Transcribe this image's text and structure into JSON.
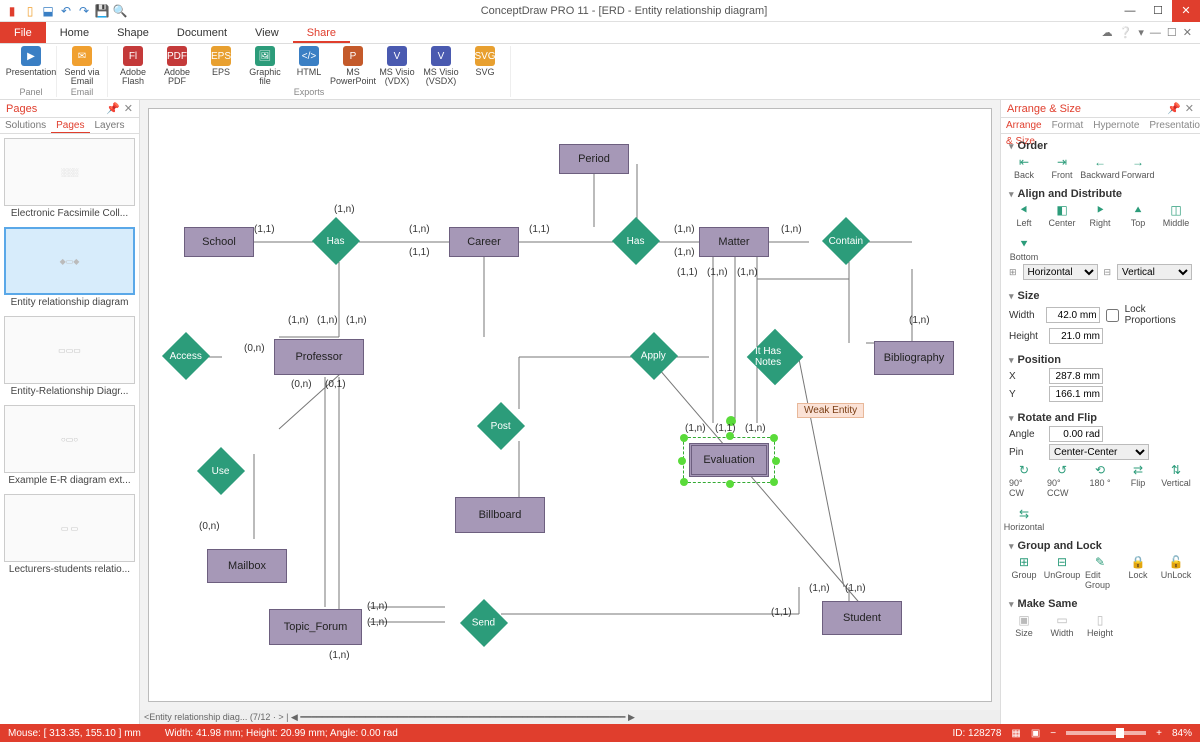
{
  "titlebar": {
    "title": "ConceptDraw PRO 11 - [ERD - Entity relationship diagram]"
  },
  "ribbon_tabs": {
    "file": "File",
    "home": "Home",
    "shape": "Shape",
    "document": "Document",
    "view": "View",
    "share": "Share"
  },
  "ribbon": {
    "panel_label": "Panel",
    "presentation": "Presentation",
    "email_label": "Email",
    "send_email": "Send via\nEmail",
    "exports_label": "Exports",
    "items": {
      "flash": "Adobe\nFlash",
      "pdf": "Adobe\nPDF",
      "eps": "EPS",
      "graphic": "Graphic\nfile",
      "html": "HTML",
      "ppt": "MS\nPowerPoint",
      "vdxv": "MS Visio\n(VDX)",
      "vsdx": "MS Visio\n(VSDX)",
      "svg": "SVG"
    }
  },
  "left_panel": {
    "title": "Pages",
    "tabs": {
      "solutions": "Solutions",
      "pages": "Pages",
      "layers": "Layers"
    },
    "thumbs": [
      {
        "label": "Electronic Facsimile Coll..."
      },
      {
        "label": "Entity relationship diagram"
      },
      {
        "label": "Entity-Relationship Diagr..."
      },
      {
        "label": "Example E-R diagram ext..."
      },
      {
        "label": "Lecturers-students relatio..."
      }
    ]
  },
  "right_panel": {
    "title": "Arrange & Size",
    "tabs": {
      "as": "Arrange & Size",
      "fmt": "Format",
      "hyp": "Hypernote",
      "pres": "Presentation"
    },
    "order": {
      "head": "Order",
      "back": "Back",
      "front": "Front",
      "backward": "Backward",
      "forward": "Forward"
    },
    "align": {
      "head": "Align and Distribute",
      "left": "Left",
      "center": "Center",
      "right": "Right",
      "top": "Top",
      "middle": "Middle",
      "bottom": "Bottom",
      "horiz": "Horizontal",
      "vert": "Vertical"
    },
    "size": {
      "head": "Size",
      "wlabel": "Width",
      "hlabel": "Height",
      "w": "42.0 mm",
      "h": "21.0 mm",
      "lock": "Lock Proportions"
    },
    "position": {
      "head": "Position",
      "xlabel": "X",
      "ylabel": "Y",
      "x": "287.8 mm",
      "y": "166.1 mm"
    },
    "rotate": {
      "head": "Rotate and Flip",
      "alabel": "Angle",
      "angle": "0.00 rad",
      "plabel": "Pin",
      "pin": "Center-Center",
      "cw": "90° CW",
      "ccw": "90° CCW",
      "180": "180 °",
      "flip": "Flip",
      "vert": "Vertical",
      "horiz": "Horizontal"
    },
    "group": {
      "head": "Group and Lock",
      "group": "Group",
      "ungroup": "UnGroup",
      "editg": "Edit\nGroup",
      "lock": "Lock",
      "unlock": "UnLock"
    },
    "make_same": {
      "head": "Make Same",
      "size": "Size",
      "width": "Width",
      "height": "Height"
    }
  },
  "statusbar": {
    "mouse": "Mouse: [ 313.35, 155.10 ] mm",
    "dims": "Width: 41.98 mm;  Height: 20.99 mm;  Angle: 0.00 rad",
    "id": "ID: 128278",
    "zoom": "84%"
  },
  "hscroll": {
    "tab": "Entity relationship diag...  (7/12"
  },
  "erd": {
    "entities": {
      "school": "School",
      "career": "Career",
      "period": "Period",
      "matter": "Matter",
      "professor": "Professor",
      "billboard": "Billboard",
      "mailbox": "Mailbox",
      "topic_forum": "Topic_Forum",
      "student": "Student",
      "bibliography": "Bibliography",
      "evaluation": "Evaluation"
    },
    "relations": {
      "has1": "Has",
      "has2": "Has",
      "contain": "Contain",
      "access": "Access",
      "apply": "Apply",
      "ithasnotes": "It Has Notes",
      "post": "Post",
      "use": "Use",
      "send": "Send"
    },
    "tooltip": "Weak Entity",
    "cards": {
      "c1": "(1,1)",
      "c2": "(1,n)",
      "c3": "(1,n)",
      "c4": "(1,1)",
      "c5": "(1,1)",
      "c6": "(1,n)",
      "c7": "(1,n)",
      "c8": "(1,n)",
      "c9": "(1,1)",
      "c10": "(1,n)",
      "c11": "(1,n)",
      "c12": "(0,n)",
      "c13": "(1,n)",
      "c14": "(1,n)",
      "c15": "(1,n)",
      "c16": "(0,n)",
      "c17": "(0,1)",
      "c18": "(1,n)",
      "c19": "(1,n)",
      "c20": "(1,1)",
      "c21": "(1,n)",
      "c22": "(0,n)",
      "c23": "(1,n)",
      "c24": "(1,n)",
      "c25": "(1,n)",
      "c26": "(1,n)",
      "c27": "(1,n)",
      "c28": "(1,1)"
    }
  }
}
